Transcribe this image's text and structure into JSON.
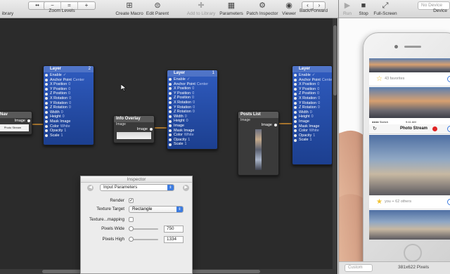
{
  "toolbar": {
    "library_label": "ibrary",
    "zoom_label": "Zoom Levels",
    "zoom_buttons": [
      "−",
      "=",
      "+"
    ],
    "create_macro": "Create Macro",
    "edit_parent": "Edit Parent",
    "add_to_library": "Add to Library",
    "parameters": "Parameters",
    "patch_inspector": "Patch Inspector",
    "viewer": "Viewer",
    "back_forward": "Back/Forward"
  },
  "viewer_toolbar": {
    "run": "Run",
    "stop": "Stop",
    "fullscreen": "Full-Screen",
    "device_placeholder": "No Device",
    "device_label": "Device"
  },
  "patches": {
    "nav": {
      "title": "Nav",
      "output": "Image",
      "preview_text": "Photo Stream"
    },
    "layer1": {
      "title": "Layer",
      "num": "2",
      "ports": [
        {
          "label": "Enable",
          "value": "✓"
        },
        {
          "label": "Anchor Point",
          "value": "Center"
        },
        {
          "label": "X Position",
          "value": "0"
        },
        {
          "label": "Y Position",
          "value": "0"
        },
        {
          "label": "Z Position",
          "value": "0"
        },
        {
          "label": "X Rotation",
          "value": "0"
        },
        {
          "label": "Y Rotation",
          "value": "0"
        },
        {
          "label": "Z Rotation",
          "value": "0"
        },
        {
          "label": "Width",
          "value": "0"
        },
        {
          "label": "Height",
          "value": "0"
        },
        {
          "label": "Mask Image",
          "value": ""
        },
        {
          "label": "Color",
          "value": "White"
        },
        {
          "label": "Opacity",
          "value": "1"
        },
        {
          "label": "Scale",
          "value": "1"
        }
      ]
    },
    "info_overlay": {
      "title": "Info Overlay",
      "subtitle": "Image",
      "output": "Image"
    },
    "layer2": {
      "title": "Layer",
      "num": "1",
      "ports": [
        {
          "label": "Enable",
          "value": "✓"
        },
        {
          "label": "Anchor Point",
          "value": "Center"
        },
        {
          "label": "X Position",
          "value": "0"
        },
        {
          "label": "Y Position",
          "value": "0"
        },
        {
          "label": "Z Position",
          "value": "0"
        },
        {
          "label": "X Rotation",
          "value": "0"
        },
        {
          "label": "Y Rotation",
          "value": "0"
        },
        {
          "label": "Z Rotation",
          "value": "0"
        },
        {
          "label": "Width",
          "value": "0"
        },
        {
          "label": "Height",
          "value": "0"
        },
        {
          "label": "Image",
          "value": ""
        },
        {
          "label": "Mask Image",
          "value": ""
        },
        {
          "label": "Color",
          "value": "White"
        },
        {
          "label": "Opacity",
          "value": "1"
        },
        {
          "label": "Scale",
          "value": "1"
        }
      ]
    },
    "posts_list": {
      "title": "Posts List",
      "subtitle": "Image",
      "output": "Image"
    },
    "layer3": {
      "title": "Layer",
      "ports": [
        {
          "label": "Enable",
          "value": "✓"
        },
        {
          "label": "Anchor Point",
          "value": "Center"
        },
        {
          "label": "X Position",
          "value": "0"
        },
        {
          "label": "Y Position",
          "value": "0"
        },
        {
          "label": "Z Position",
          "value": "0"
        },
        {
          "label": "X Rotation",
          "value": "0"
        },
        {
          "label": "Y Rotation",
          "value": "0"
        },
        {
          "label": "Z Rotation",
          "value": "0"
        },
        {
          "label": "Width",
          "value": "0"
        },
        {
          "label": "Height",
          "value": "0"
        },
        {
          "label": "Image",
          "value": ""
        },
        {
          "label": "Mask Image",
          "value": ""
        },
        {
          "label": "Color",
          "value": "White"
        },
        {
          "label": "Opacity",
          "value": "1"
        },
        {
          "label": "Scale",
          "value": "1"
        }
      ]
    }
  },
  "inspector": {
    "title": "Inspector",
    "section": "Input Parameters",
    "render_label": "Render",
    "texture_target_label": "Texture Target",
    "texture_target_value": "Rectangle",
    "texture_mapping_label": "Texture...mapping",
    "pixels_wide_label": "Pixels Wide",
    "pixels_wide_value": "750",
    "pixels_high_label": "Pixels High",
    "pixels_high_value": "1334"
  },
  "viewer": {
    "zoom_placeholder": "Custom",
    "pixel_size": "381x622 Pixels",
    "app": {
      "fav1": "43 favorites",
      "fav2": "you + 62 others",
      "status_left": "●●●● Sketch",
      "status_time": "9:41 AM",
      "nav_title": "Photo Stream"
    }
  },
  "colors": {
    "canvas": "#2b2b2b",
    "patch_blue": "#2f5bbf",
    "accent": "#3c7be0",
    "record": "#e02424"
  }
}
